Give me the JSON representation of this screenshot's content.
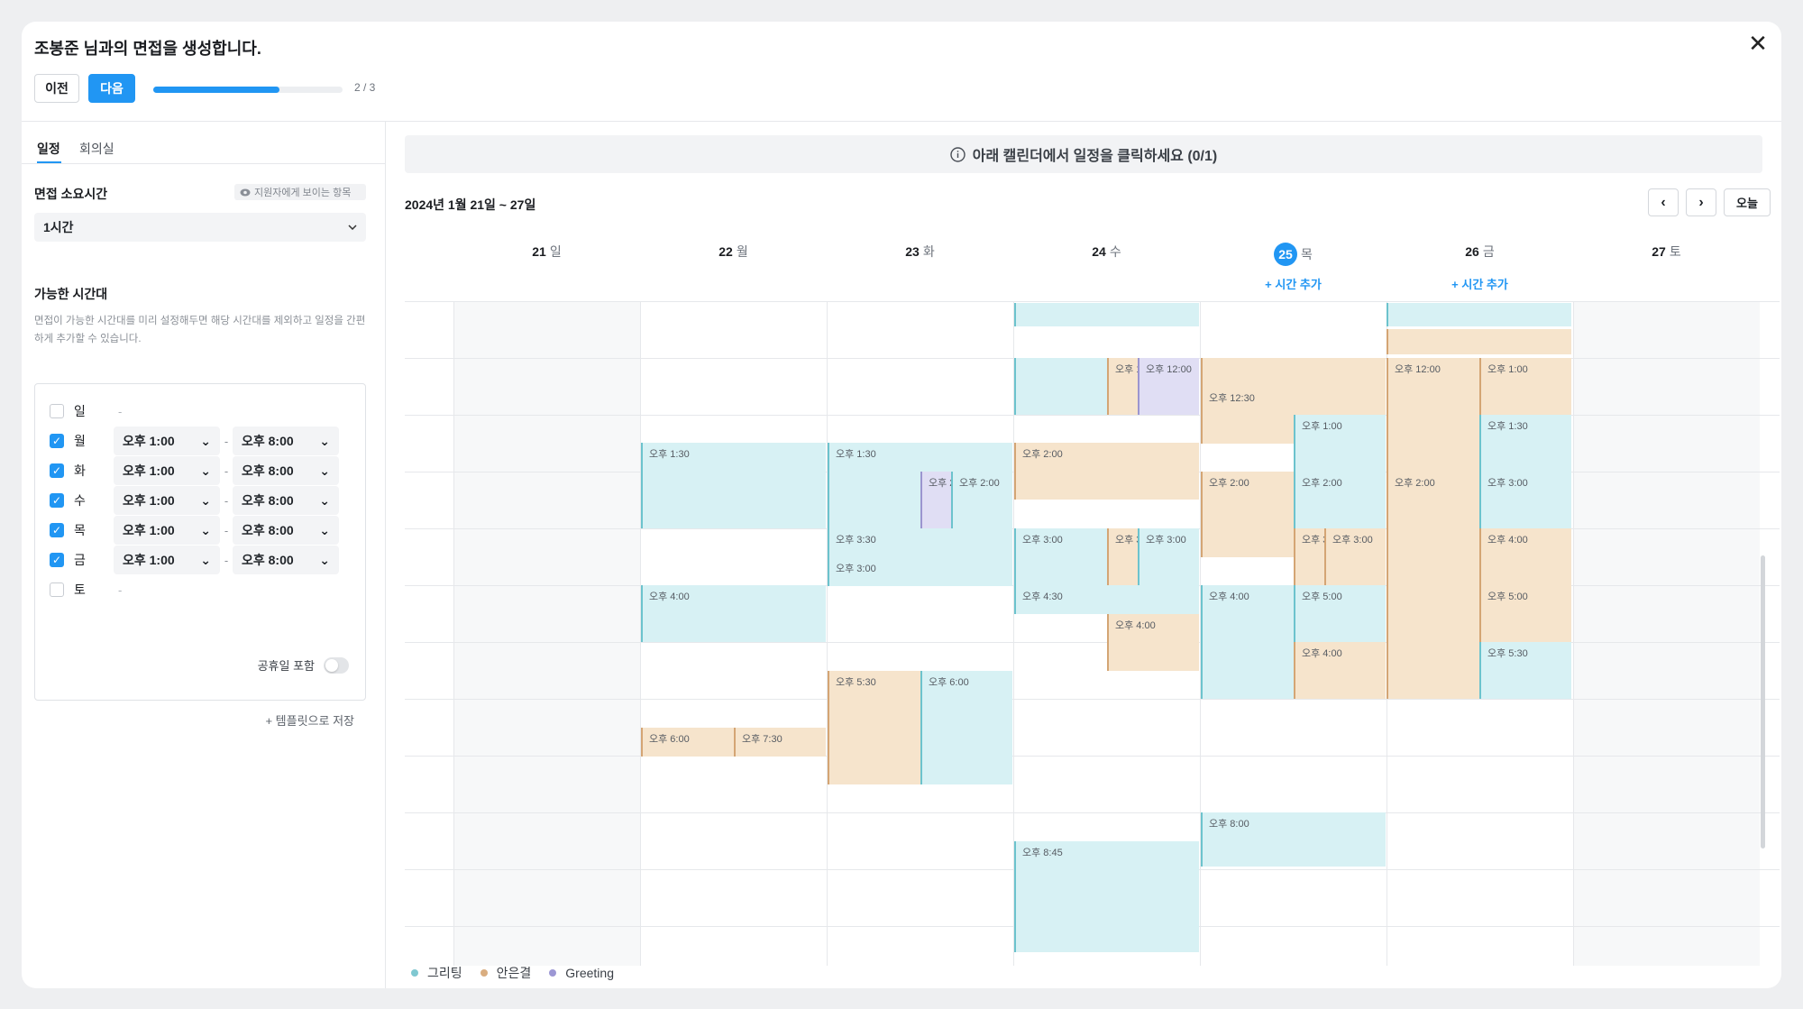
{
  "header": {
    "title": "조봉준 님과의 면접을 생성합니다.",
    "prev_label": "이전",
    "next_label": "다음",
    "progress_fraction": 0.667,
    "step_text": "2 / 3",
    "close_icon": "✕"
  },
  "sidebar": {
    "tabs": [
      {
        "label": "일정",
        "active": true
      },
      {
        "label": "회의실",
        "active": false
      }
    ],
    "duration_title": "면접 소요시간",
    "visible_chip": "지원자에게 보이는 항목",
    "duration_value": "1시간",
    "available_title": "가능한 시간대",
    "available_desc": "면접이 가능한 시간대를 미리 설정해두면 해당 시간대를 제외하고 일정을 간편하게 추가할 수 있습니다.",
    "days": [
      {
        "label": "일",
        "checked": false,
        "start": "",
        "end": "",
        "empty": "-"
      },
      {
        "label": "월",
        "checked": true,
        "start": "오후 1:00",
        "end": "오후 8:00"
      },
      {
        "label": "화",
        "checked": true,
        "start": "오후 1:00",
        "end": "오후 8:00"
      },
      {
        "label": "수",
        "checked": true,
        "start": "오후 1:00",
        "end": "오후 8:00"
      },
      {
        "label": "목",
        "checked": true,
        "start": "오후 1:00",
        "end": "오후 8:00"
      },
      {
        "label": "금",
        "checked": true,
        "start": "오후 1:00",
        "end": "오후 8:00"
      },
      {
        "label": "토",
        "checked": false,
        "start": "",
        "end": "",
        "empty": "-"
      }
    ],
    "time_separator": "-",
    "holiday_label": "공휴일 포함",
    "template_label": "+  템플릿으로 저장"
  },
  "calendar": {
    "banner": "아래 캘린더에서 일정을 클릭하세요 (0/1)",
    "range": "2024년 1월 21일 ~ 27일",
    "today_label": "오늘",
    "prev_icon": "‹",
    "next_icon": "›",
    "days": [
      {
        "num": "21",
        "wd": "일",
        "today": false
      },
      {
        "num": "22",
        "wd": "월",
        "today": false
      },
      {
        "num": "23",
        "wd": "화",
        "today": false
      },
      {
        "num": "24",
        "wd": "수",
        "today": false
      },
      {
        "num": "25",
        "wd": "목",
        "today": true
      },
      {
        "num": "26",
        "wd": "금",
        "today": false
      },
      {
        "num": "27",
        "wd": "토",
        "today": false
      }
    ],
    "add_time_label": "+  시간 추가",
    "events": [
      {
        "day": 3,
        "start": "",
        "color": "t"
      },
      {
        "day": 5,
        "start": "",
        "color": "t"
      },
      {
        "day": 5,
        "start": "",
        "color": "o"
      },
      {
        "day": 3,
        "start": "",
        "color": "t"
      },
      {
        "day": 3,
        "start": "오후 12:00",
        "color": "o"
      },
      {
        "day": 3,
        "start": "오후 12:00",
        "color": "p"
      },
      {
        "day": 4,
        "start": "",
        "color": "o"
      },
      {
        "day": 4,
        "start": "오후 12:30",
        "color": "o"
      },
      {
        "day": 4,
        "start": "오후 1:00",
        "color": "t"
      },
      {
        "day": 5,
        "start": "오후 12:00",
        "color": "o"
      },
      {
        "day": 5,
        "start": "오후 1:00",
        "color": "o"
      },
      {
        "day": 1,
        "start": "오후 1:30",
        "color": "t"
      },
      {
        "day": 2,
        "start": "오후 1:30",
        "color": "t"
      },
      {
        "day": 3,
        "start": "오후 1:30",
        "color": "t"
      },
      {
        "day": 2,
        "start": "오후 2:00",
        "color": "o"
      },
      {
        "day": 2,
        "start": "오후 2:00",
        "color": "p"
      },
      {
        "day": 4,
        "start": "오후 2:00",
        "color": "t"
      },
      {
        "day": 4,
        "start": "오후 2:00",
        "color": "o"
      },
      {
        "day": 5,
        "start": "오후 2:00",
        "color": "t"
      },
      {
        "day": 5,
        "start": "오후 2:00",
        "color": "o"
      },
      {
        "day": 2,
        "start": "오후 3:00",
        "color": "t"
      },
      {
        "day": 2,
        "start": "오후 3:30",
        "color": "t"
      },
      {
        "day": 3,
        "start": "오후 3:00",
        "color": "t"
      },
      {
        "day": 3,
        "start": "오후 3:00",
        "color": "t"
      },
      {
        "day": 3,
        "start": "오후 3:00",
        "color": "o"
      },
      {
        "day": 4,
        "start": "오후 3:00",
        "color": "t"
      },
      {
        "day": 4,
        "start": "오후 3:00",
        "color": "o"
      },
      {
        "day": 5,
        "start": "오후 3:00",
        "color": "o"
      },
      {
        "day": 1,
        "start": "오후 4:00",
        "color": "o"
      },
      {
        "day": 3,
        "start": "오후 4:00",
        "color": "t"
      },
      {
        "day": 3,
        "start": "오후 4:30",
        "color": "t"
      },
      {
        "day": 4,
        "start": "오후 4:00",
        "color": "o"
      },
      {
        "day": 4,
        "start": "오후 4:00",
        "color": "t"
      },
      {
        "day": 4,
        "start": "오후 5:00",
        "color": "t"
      },
      {
        "day": 5,
        "start": "오후 4:00",
        "color": "o"
      },
      {
        "day": 5,
        "start": "오후 5:00",
        "color": "o"
      },
      {
        "day": 2,
        "start": "오후 5:30",
        "color": "t"
      },
      {
        "day": 2,
        "start": "오후 5:30",
        "color": "o"
      },
      {
        "day": 1,
        "start": "오후 6:00",
        "color": "t"
      },
      {
        "day": 1,
        "start": "오후 6:00",
        "color": "o"
      },
      {
        "day": 4,
        "start": "오후 7:30",
        "color": "o"
      },
      {
        "day": 3,
        "start": "오후 8:00",
        "color": "t"
      },
      {
        "day": 3,
        "start": "오후 8:45",
        "color": "t"
      }
    ],
    "legend": [
      {
        "label": "그리팅",
        "color": "#7fc8d1"
      },
      {
        "label": "안은결",
        "color": "#d9ad80"
      },
      {
        "label": "Greeting",
        "color": "#9c97d4"
      }
    ]
  }
}
